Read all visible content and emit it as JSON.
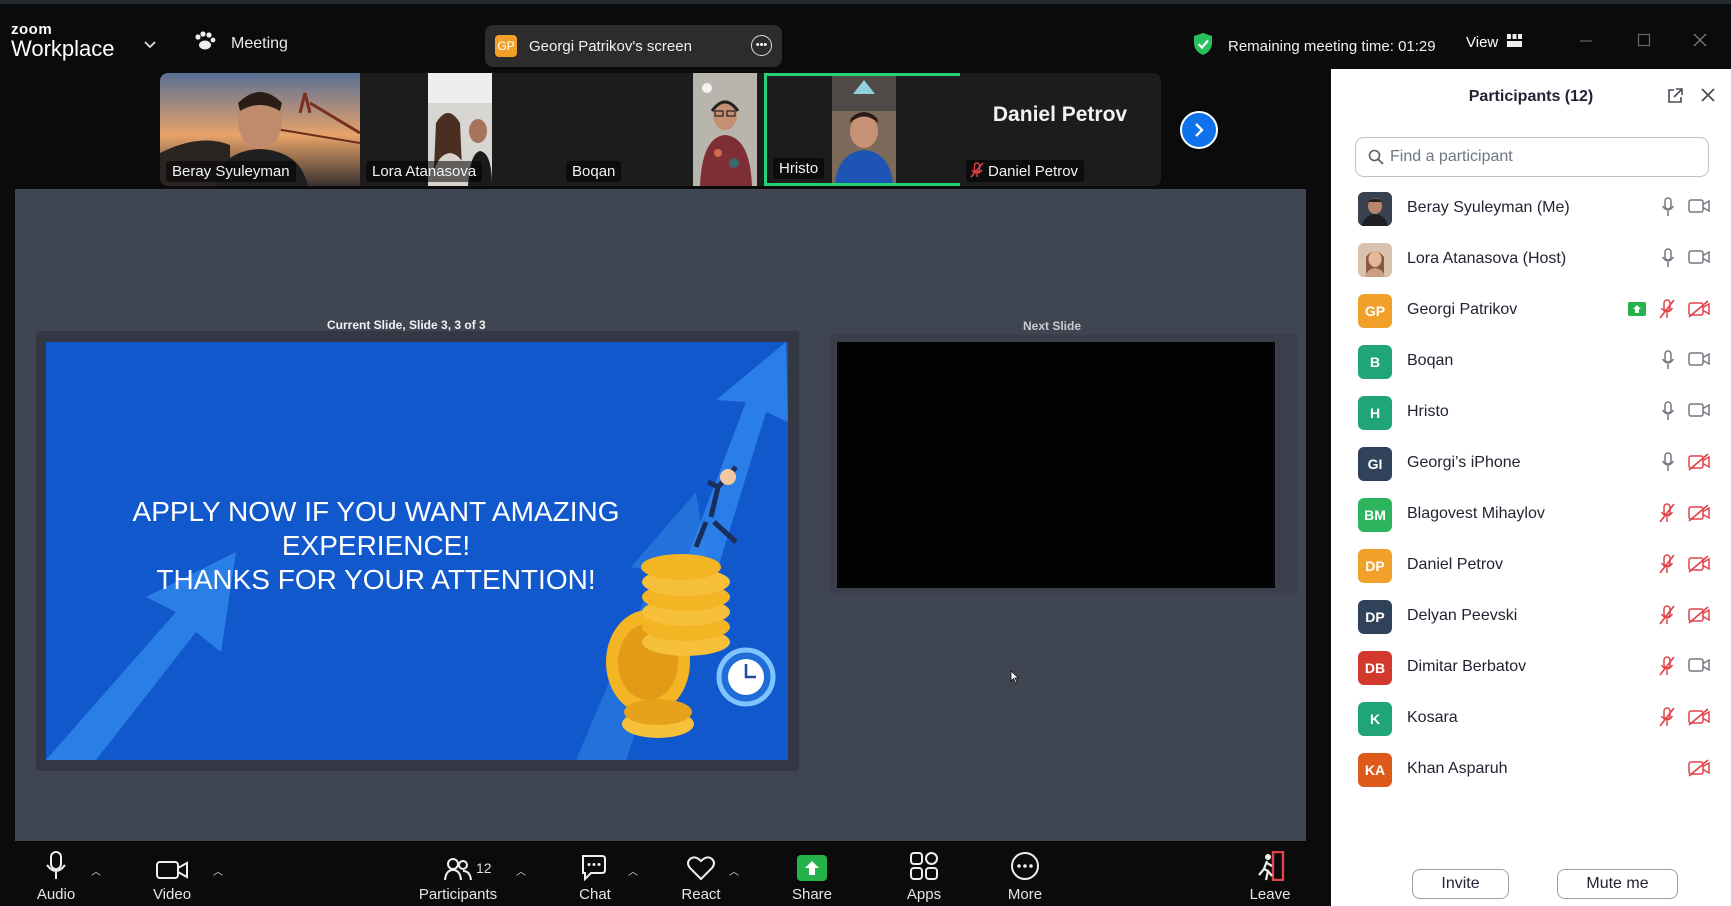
{
  "app": {
    "brand_top": "zoom",
    "brand_bottom": "Workplace",
    "meeting_label": "Meeting"
  },
  "share_pill": {
    "badge": "GP",
    "label": "Georgi Patrikov's screen"
  },
  "status": {
    "remaining_time": "Remaining meeting time: 01:29",
    "view_label": "View"
  },
  "thumbnails": [
    {
      "name": "Beray Syuleyman"
    },
    {
      "name": "Lora Atanasova"
    },
    {
      "name": "Boqan"
    },
    {
      "name": "Hristo",
      "active": true
    },
    {
      "name": "Daniel Petrov",
      "big_name": "Daniel Petrov",
      "muted": true
    }
  ],
  "presentation": {
    "current_caption": "Current Slide, Slide 3, 3 of 3",
    "next_caption": "Next Slide",
    "slide_lines": [
      "APPLY NOW IF YOU WANT AMAZING",
      "EXPERIENCE!",
      "THANKS FOR YOUR ATTENTION!"
    ]
  },
  "toolbar": {
    "audio": "Audio",
    "video": "Video",
    "participants": "Participants",
    "participants_count": "12",
    "chat": "Chat",
    "react": "React",
    "share": "Share",
    "apps": "Apps",
    "more": "More",
    "leave": "Leave"
  },
  "panel": {
    "title": "Participants (12)",
    "search_placeholder": "Find a participant",
    "invite": "Invite",
    "mute_me": "Mute me",
    "participants": [
      {
        "name": "Beray Syuleyman (Me)",
        "initials": "",
        "avatar_color": "#3a4250",
        "photo": true,
        "mic": "on",
        "cam": "on"
      },
      {
        "name": "Lora Atanasova (Host)",
        "initials": "",
        "avatar_color": "#c9a083",
        "photo": true,
        "mic": "on",
        "cam": "on"
      },
      {
        "name": "Georgi Patrikov",
        "initials": "GP",
        "avatar_color": "#f1a02a",
        "sharing": true,
        "mic": "muted",
        "cam": "off"
      },
      {
        "name": "Boqan",
        "initials": "B",
        "avatar_color": "#20a57a",
        "mic": "on",
        "cam": "on"
      },
      {
        "name": "Hristo",
        "initials": "H",
        "avatar_color": "#20a57a",
        "mic": "on",
        "cam": "on"
      },
      {
        "name": "Georgi’s iPhone",
        "initials": "GI",
        "avatar_color": "#2f4259",
        "mic": "on",
        "cam": "off"
      },
      {
        "name": "Blagovest Mihaylov",
        "initials": "BM",
        "avatar_color": "#2db55d",
        "mic": "muted",
        "cam": "off"
      },
      {
        "name": "Daniel Petrov",
        "initials": "DP",
        "avatar_color": "#f1a02a",
        "mic": "muted",
        "cam": "off"
      },
      {
        "name": "Delyan Peevski",
        "initials": "DP",
        "avatar_color": "#2f4259",
        "mic": "muted",
        "cam": "off"
      },
      {
        "name": "Dimitar Berbatov",
        "initials": "DB",
        "avatar_color": "#d0392b",
        "mic": "muted",
        "cam": "on"
      },
      {
        "name": "Kosara",
        "initials": "K",
        "avatar_color": "#20a57a",
        "mic": "muted",
        "cam": "off"
      },
      {
        "name": "Khan Asparuh",
        "initials": "KA",
        "avatar_color": "#de5a1a",
        "mic": "none",
        "cam": "off"
      }
    ]
  },
  "colors": {
    "accent_blue": "#0e72ed",
    "active_green": "#25d276",
    "muted_red": "#e0434a",
    "share_green": "#25b24a"
  }
}
